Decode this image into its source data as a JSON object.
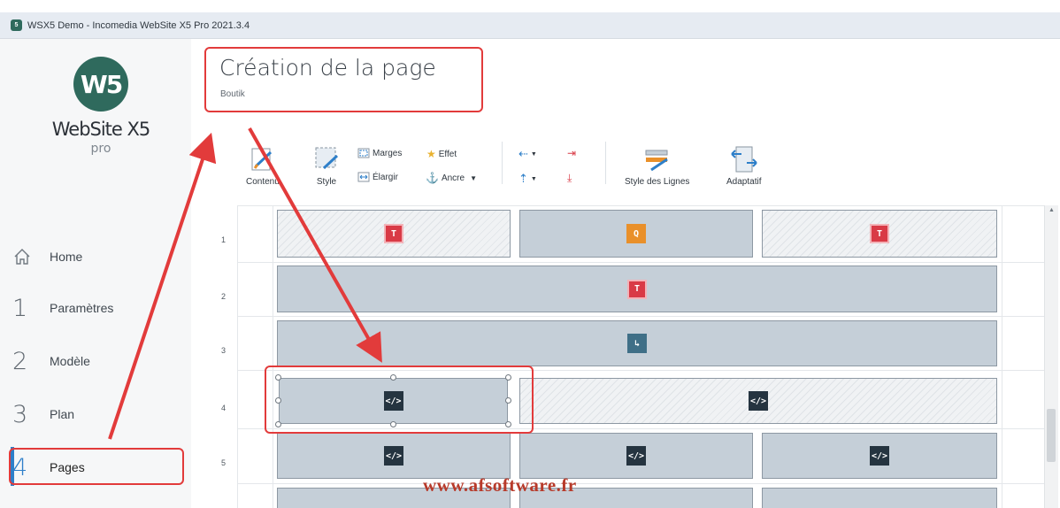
{
  "window": {
    "title": "WSX5 Demo - Incomedia WebSite X5 Pro 2021.3.4"
  },
  "logo": {
    "mark": "W5",
    "name": "WebSite X5",
    "edition": "pro"
  },
  "sidebar": {
    "items": [
      {
        "num": "",
        "label": "Home",
        "icon": "home-icon"
      },
      {
        "num": "1",
        "label": "Paramètres"
      },
      {
        "num": "2",
        "label": "Modèle"
      },
      {
        "num": "3",
        "label": "Plan"
      },
      {
        "num": "4",
        "label": "Pages",
        "active": true
      }
    ]
  },
  "header": {
    "title": "Création de la page",
    "subtitle": "Boutik"
  },
  "toolbar": {
    "contenu": "Contenu",
    "style": "Style",
    "marges": "Marges",
    "effet": "Effet",
    "elargir": "Élargir",
    "ancre": "Ancre",
    "style_lignes": "Style des Lignes",
    "adaptatif": "Adaptatif"
  },
  "grid": {
    "rows": [
      {
        "num": "1",
        "cells": [
          {
            "icon": "text-object-icon",
            "glyph": "T",
            "hatched": true
          },
          {
            "icon": "search-object-icon",
            "glyph": "Q",
            "hatched": false
          },
          {
            "icon": "text-object-icon",
            "glyph": "T",
            "hatched": true
          }
        ]
      },
      {
        "num": "2",
        "cells": [
          {
            "icon": "text-object-icon",
            "glyph": "T",
            "hatched": false
          }
        ]
      },
      {
        "num": "3",
        "cells": [
          {
            "icon": "cart-object-icon",
            "glyph": "↳",
            "hatched": false
          }
        ]
      },
      {
        "num": "4",
        "cells": [
          {
            "icon": "html-object-icon",
            "glyph": "</>",
            "hatched": false,
            "selected": true
          },
          {
            "icon": "html-object-icon",
            "glyph": "</>",
            "hatched": true
          }
        ]
      },
      {
        "num": "5",
        "cells": [
          {
            "icon": "html-object-icon",
            "glyph": "</>",
            "hatched": false
          },
          {
            "icon": "html-object-icon",
            "glyph": "</>",
            "hatched": false
          },
          {
            "icon": "html-object-icon",
            "glyph": "</>",
            "hatched": false
          }
        ]
      }
    ]
  },
  "watermark": "www.afsoftware.fr",
  "colors": {
    "accent": "#2e7fc9",
    "annotation": "#e23b3b",
    "brand": "#2f6a5d"
  }
}
